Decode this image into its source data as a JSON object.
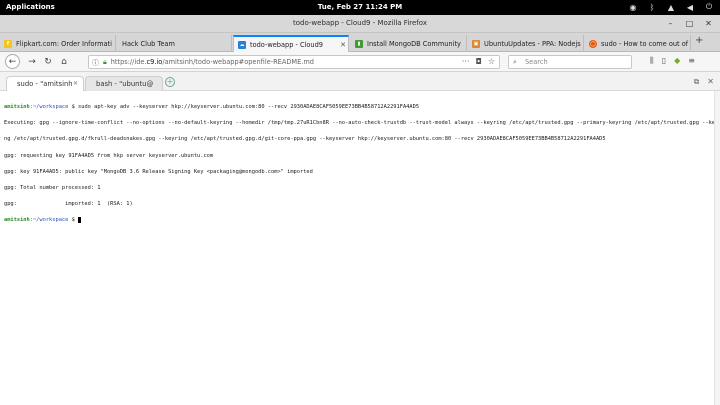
{
  "topbar": {
    "applications": "Applications",
    "clock": "Tue, Feb 27   11:24 PM",
    "tray_icons": [
      "disc-icon",
      "bluetooth-icon",
      "wifi-icon",
      "volume-icon",
      "power-icon"
    ]
  },
  "window": {
    "title": "todo-webapp - Cloud9 - Mozilla Firefox"
  },
  "tabs": [
    {
      "label": "Flipkart.com: Order Informati",
      "favicon_color": "#f5c518",
      "active": false
    },
    {
      "label": "Hack Club Team",
      "favicon_color": "",
      "active": false
    },
    {
      "label": "todo-webapp - Cloud9",
      "favicon_color": "#2d7fd3",
      "active": true
    },
    {
      "label": "Install MongoDB Community",
      "favicon_color": "#3f9c35",
      "active": false
    },
    {
      "label": "UbuntuUpdates - PPA: Nodejs",
      "favicon_color": "#dd8833",
      "active": false
    },
    {
      "label": "sudo - How to come out of m",
      "favicon_color": "#e55b13",
      "active": false
    }
  ],
  "navbar": {
    "url_prefix": "https://ide.",
    "url_host": "c9.io",
    "url_path": "/amitsinh/todo-webapp#openfile-README.md",
    "search_placeholder": "Search"
  },
  "c9_tabs": [
    {
      "label": "sudo - \"amitsinh",
      "active": true
    },
    {
      "label": "bash - \"ubuntu@",
      "active": false
    }
  ],
  "terminal": {
    "lines": [
      {
        "user": "amitsinh",
        "path": ":~/workspace",
        "cmd": " $ sudo apt-key adv --keyserver hkp://keyserver.ubuntu.com:80 --recv 2930ADAE8CAF5059EE73BB4B58712A2291FA4AD5"
      },
      {
        "text": "Executing: gpg --ignore-time-conflict --no-options --no-default-keyring --homedir /tmp/tmp.27uR1Cbn8R --no-auto-check-trustdb --trust-model always --keyring /etc/apt/trusted.gpg --primary-keyring /etc/apt/trusted.gpg --keyri"
      },
      {
        "text": "ng /etc/apt/trusted.gpg.d/fkrull-deadsnakes.gpg --keyring /etc/apt/trusted.gpg.d/git-core-ppa.gpg --keyserver hkp://keyserver.ubuntu.com:80 --recv 2930ADAE8CAF5059EE73BB4B58712A2291FA4AD5"
      },
      {
        "text": "gpg: requesting key 91FA4AD5 from hkp server keyserver.ubuntu.com"
      },
      {
        "text": "gpg: key 91FA4AD5: public key \"MongoDB 3.6 Release Signing Key <packaging@mongodb.com>\" imported"
      },
      {
        "text": "gpg: Total number processed: 1"
      },
      {
        "text": "gpg:               imported: 1  (RSA: 1)"
      },
      {
        "user": "amitsinh",
        "path": ":~/workspace",
        "cmd": " $ "
      }
    ]
  }
}
